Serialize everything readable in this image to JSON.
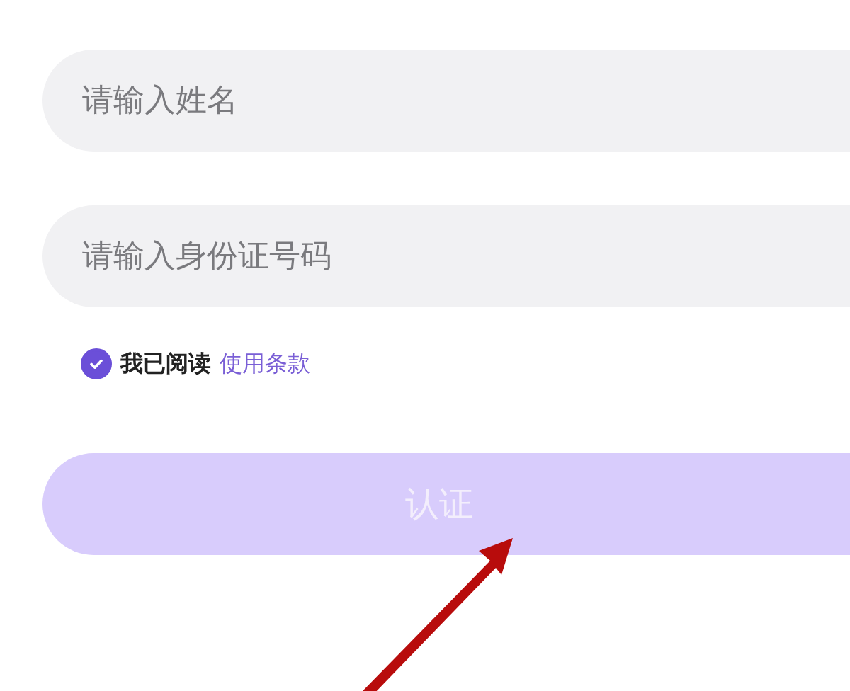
{
  "fields": [
    {
      "placeholder": "请输入姓名"
    },
    {
      "placeholder": "请输入身份证号码"
    }
  ],
  "agreement": {
    "checked": true,
    "text": "我已阅读",
    "link": "使用条款"
  },
  "submit": {
    "label": "认证",
    "disabled": true
  },
  "annotation": {
    "kind": "arrow"
  }
}
